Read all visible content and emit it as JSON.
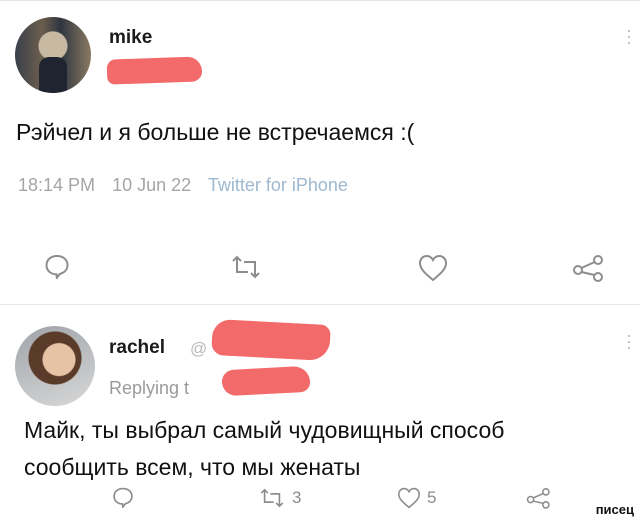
{
  "tweet1": {
    "username": "mike",
    "text": "Рэйчел и я больше не встречаемся :(",
    "time": "18:14 PM",
    "date": "10 Jun 22",
    "source": "Twitter for iPhone",
    "actions": {
      "reply_icon": "comment-icon",
      "retweet_icon": "retweet-icon",
      "like_icon": "heart-icon",
      "share_icon": "share-icon"
    }
  },
  "tweet2": {
    "username": "rachel",
    "handle_prefix": "@",
    "replying": "Replying t",
    "text": "Майк, ты выбрал самый чудовищный способ сообщить всем, что мы женаты",
    "retweets": "3",
    "likes": "5"
  },
  "watermark": "писец",
  "colors": {
    "redaction": "#f26a6a",
    "muted": "#a5a5a5",
    "source_link": "#9db8cf"
  }
}
